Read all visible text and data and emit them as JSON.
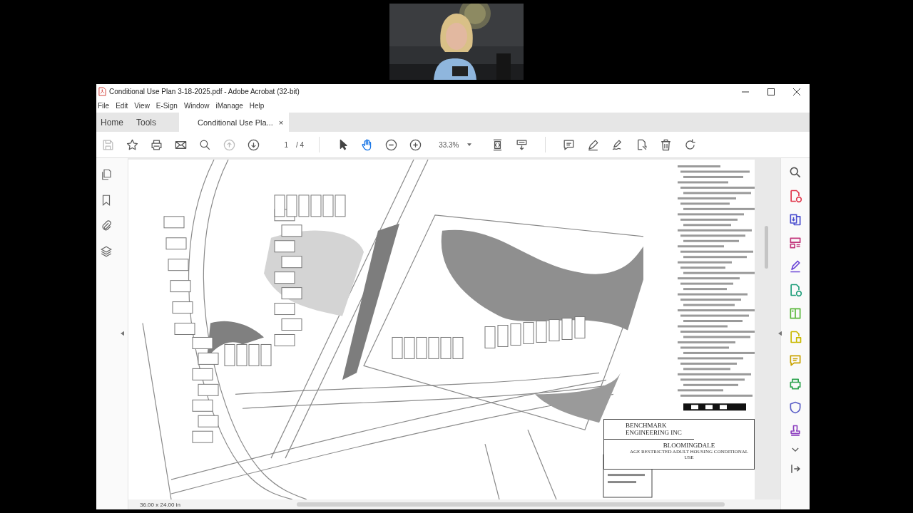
{
  "window": {
    "title": "Conditional Use Plan 3-18-2025.pdf - Adobe Acrobat (32-bit)"
  },
  "menu": [
    "File",
    "Edit",
    "View",
    "E-Sign",
    "Window",
    "iManage",
    "Help"
  ],
  "tabs": [
    {
      "label": "Home",
      "selected": false
    },
    {
      "label": "Tools",
      "selected": false
    },
    {
      "label": "Conditional Use Pla...",
      "selected": true,
      "close": "×"
    }
  ],
  "toolbar": {
    "page": "1",
    "pages": "/ 4",
    "zoom": "33.3%"
  },
  "document": {
    "title_block": {
      "firm": "BENCHMARK",
      "firm_line2": "ENGINEERING INC",
      "project": "BLOOMINGDALE",
      "subtitle": "AGE RESTRICTED ADULT HOUSING CONDITIONAL USE"
    }
  },
  "status_bar": {
    "page_size": "36.00 x 24.00 in"
  }
}
